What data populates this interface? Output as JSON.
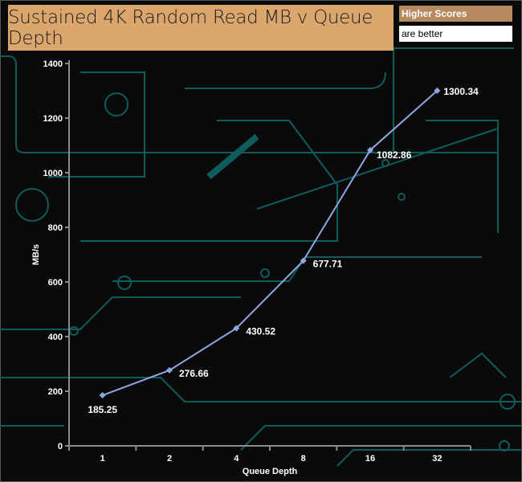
{
  "chart_data": {
    "type": "line",
    "title": "Sustained 4K Random Read MB v Queue Depth",
    "xlabel": "Queue Depth",
    "ylabel": "MB/s",
    "categories": [
      "1",
      "2",
      "4",
      "8",
      "16",
      "32"
    ],
    "series": [
      {
        "values": [
          185.25,
          276.66,
          430.52,
          677.71,
          1082.86,
          1300.34
        ],
        "color": "#8fa6e0"
      }
    ],
    "data_labels": [
      "185.25",
      "276.66",
      "430.52",
      "677.71",
      "1082.86",
      "1300.34"
    ],
    "ylim": [
      0,
      1400
    ],
    "yticks": [
      "0",
      "200",
      "400",
      "600",
      "800",
      "1000",
      "1200",
      "1400"
    ],
    "grid": false,
    "legend": "none"
  },
  "notes": {
    "line1": "Higher Scores",
    "line2": "are better"
  },
  "colors": {
    "title_bg": "#dba66e",
    "note_bg": "#b58a5e",
    "circuit": "#0e5c5c",
    "axis": "#8a8a8a"
  }
}
